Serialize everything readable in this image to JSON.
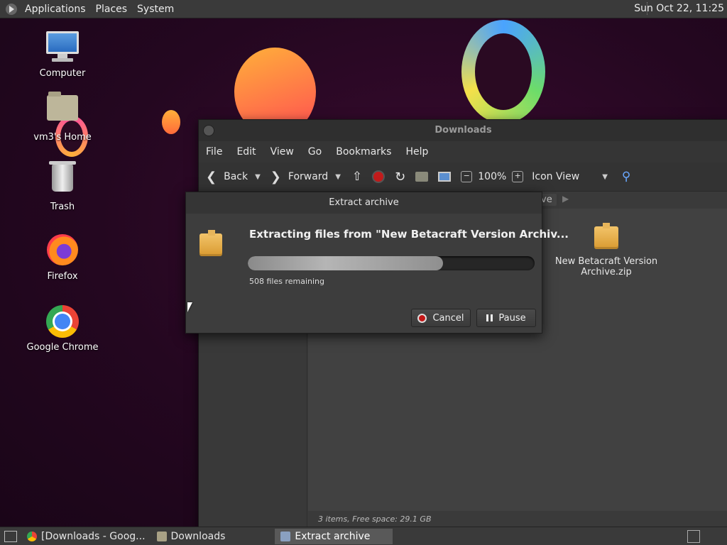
{
  "top_panel": {
    "menus": [
      "Applications",
      "Places",
      "System"
    ],
    "clock": "Sun Oct 22, 11:25"
  },
  "desktop_icons": [
    {
      "label": "Computer",
      "icon": "computer-icon"
    },
    {
      "label": "vm3's Home",
      "icon": "home-folder-icon"
    },
    {
      "label": "Trash",
      "icon": "trash-icon"
    },
    {
      "label": "Firefox",
      "icon": "firefox-icon"
    },
    {
      "label": "Google Chrome",
      "icon": "chrome-icon"
    }
  ],
  "file_manager": {
    "title": "Downloads",
    "menus": [
      "File",
      "Edit",
      "View",
      "Go",
      "Bookmarks",
      "Help"
    ],
    "toolbar": {
      "back_label": "Back",
      "forward_label": "Forward",
      "zoom": "100%",
      "view_mode": "Icon View"
    },
    "path_crumb": "ve",
    "file": {
      "name": "New Betacraft Version Archive.zip",
      "icon": "package-icon"
    },
    "status": "3 items, Free space: 29.1 GB"
  },
  "dialog": {
    "title": "Extract archive",
    "heading": "Extracting files from \"New Betacraft Version Archiv...",
    "progress": 0.68,
    "remaining": "508 files remaining",
    "cancel_label": "Cancel",
    "pause_label": "Pause"
  },
  "taskbar": {
    "tasks": [
      {
        "label": "[Downloads - Goog...",
        "icon": "chrome-icon",
        "active": false
      },
      {
        "label": "Downloads",
        "icon": "folder-icon",
        "active": false
      },
      {
        "label": "Extract archive",
        "icon": "archive-icon",
        "active": true
      }
    ]
  },
  "colors": {
    "panel": "#3a3a3a",
    "dialog_bg": "#3d3d3d",
    "stop_red": "#c21b1b",
    "desktop": "#2a0a22"
  }
}
